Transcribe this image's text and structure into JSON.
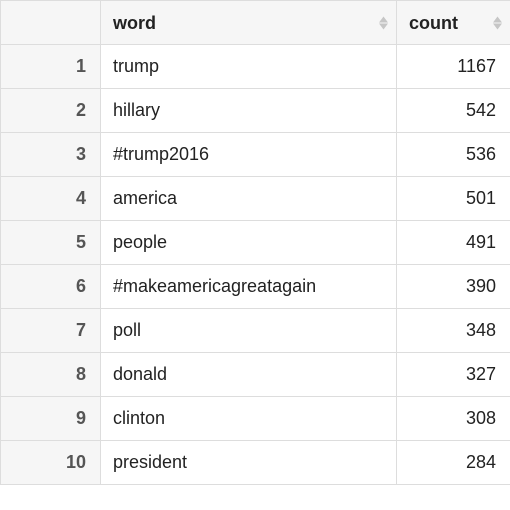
{
  "columns": {
    "word": "word",
    "count": "count"
  },
  "rows": [
    {
      "n": 1,
      "word": "trump",
      "count": 1167
    },
    {
      "n": 2,
      "word": "hillary",
      "count": 542
    },
    {
      "n": 3,
      "word": "#trump2016",
      "count": 536
    },
    {
      "n": 4,
      "word": "america",
      "count": 501
    },
    {
      "n": 5,
      "word": "people",
      "count": 491
    },
    {
      "n": 6,
      "word": "#makeamericagreatagain",
      "count": 390
    },
    {
      "n": 7,
      "word": "poll",
      "count": 348
    },
    {
      "n": 8,
      "word": "donald",
      "count": 327
    },
    {
      "n": 9,
      "word": "clinton",
      "count": 308
    },
    {
      "n": 10,
      "word": "president",
      "count": 284
    }
  ]
}
